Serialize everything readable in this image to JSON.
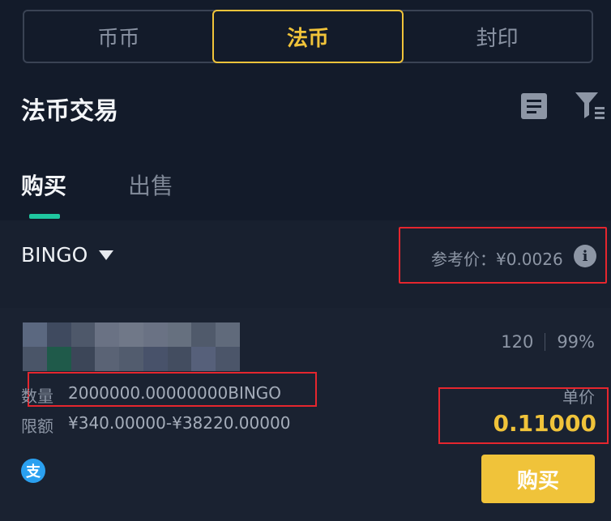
{
  "segments": {
    "items": [
      "币币",
      "法币",
      "封印"
    ],
    "active_index": 1
  },
  "page_title": "法币交易",
  "icons": {
    "order": "order-list-icon",
    "filter": "filter-icon",
    "info": "info-icon",
    "payment": "alipay-icon"
  },
  "tabs": {
    "buy": "购买",
    "sell": "出售",
    "active": "buy"
  },
  "coin": {
    "name": "BINGO"
  },
  "reference_price": "参考价：¥0.0026",
  "info_glyph": "i",
  "merchant": {
    "orders": "120",
    "completion": "99%",
    "quantity_label": "数量",
    "quantity_value": "2000000.00000000BINGO",
    "limit_label": "限额",
    "limit_value": "¥340.00000-¥38220.00000",
    "unit_price_label": "单价",
    "unit_price": "0.11000",
    "payment_glyph": "支",
    "buy_button": "购买"
  },
  "colors": {
    "accent": "#f0c33a",
    "tab_indicator": "#1fc7a0",
    "highlight_box": "#e5262e",
    "background": "#141c2b"
  }
}
